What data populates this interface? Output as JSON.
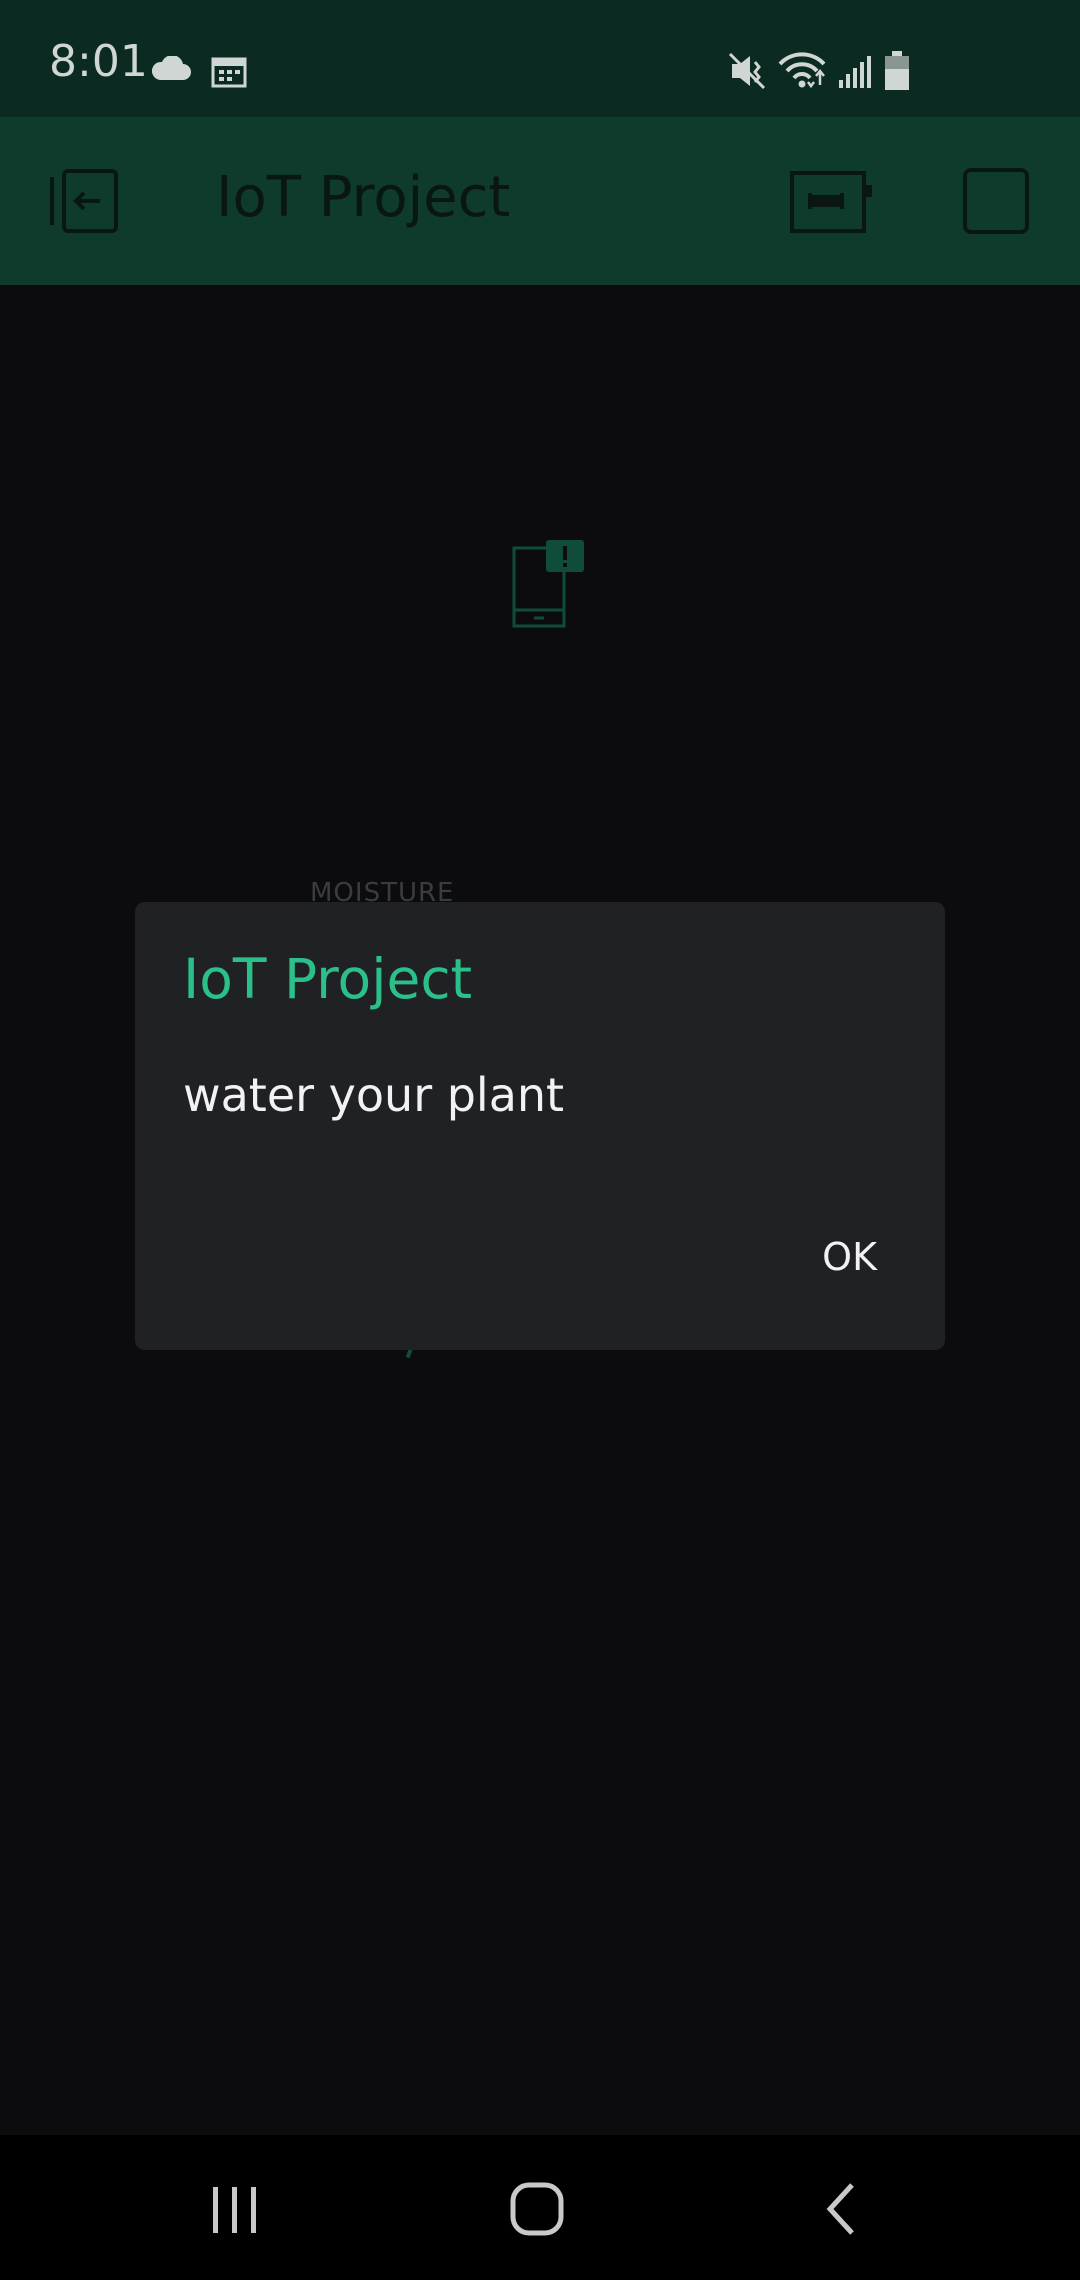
{
  "status_bar": {
    "time": "8:01",
    "left_icons": [
      "cloud-icon",
      "calendar-icon"
    ],
    "right_icons": [
      "mute-icon",
      "wifi-icon",
      "signal-icon",
      "battery-icon"
    ]
  },
  "app_bar": {
    "title": "IoT Project",
    "icons": [
      "exit-icon",
      "device-icon",
      "stop-square-icon"
    ]
  },
  "background": {
    "notification_widget_icon": "phone-notification-icon",
    "moisture_label": "MOISTURE"
  },
  "dialog": {
    "title": "IoT Project",
    "message": "water your plant",
    "ok_label": "OK"
  },
  "nav_bar": {
    "icons": [
      "recent-apps-icon",
      "home-icon",
      "back-icon"
    ]
  },
  "colors": {
    "status_bar_bg": "#0b2a21",
    "app_bar_bg": "#0f3b2c",
    "accent": "#2bbf8a",
    "dialog_bg": "#202124",
    "screen_bg": "#0c0c0e"
  }
}
